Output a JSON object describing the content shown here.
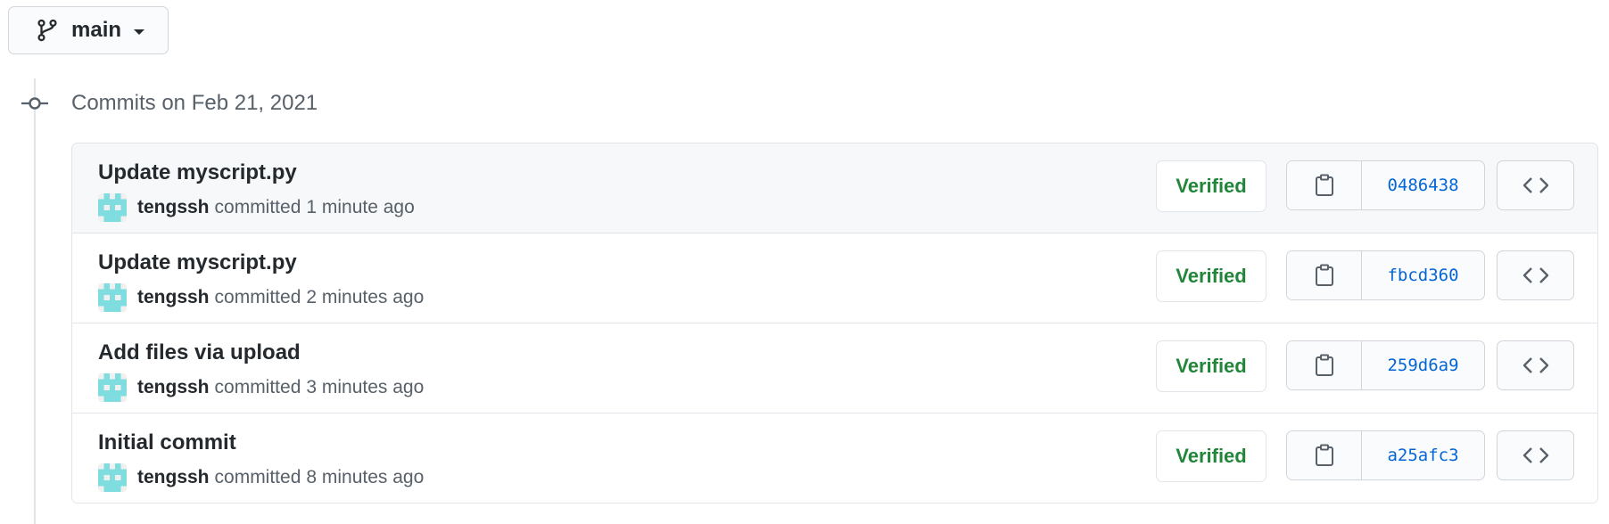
{
  "branch": {
    "name": "main",
    "icon": "git-branch-icon"
  },
  "group": {
    "heading": "Commits on Feb 21, 2021"
  },
  "commits": [
    {
      "title": "Update myscript.py",
      "author": "tengssh",
      "committed_word": "committed",
      "time": "1 minute ago",
      "badge": "Verified",
      "sha": "0486438"
    },
    {
      "title": "Update myscript.py",
      "author": "tengssh",
      "committed_word": "committed",
      "time": "2 minutes ago",
      "badge": "Verified",
      "sha": "fbcd360"
    },
    {
      "title": "Add files via upload",
      "author": "tengssh",
      "committed_word": "committed",
      "time": "3 minutes ago",
      "badge": "Verified",
      "sha": "259d6a9"
    },
    {
      "title": "Initial commit",
      "author": "tengssh",
      "committed_word": "committed",
      "time": "8 minutes ago",
      "badge": "Verified",
      "sha": "a25afc3"
    }
  ],
  "colors": {
    "verified": "#22863a",
    "sha_link": "#0366d6",
    "border": "#e1e4e8",
    "avatar": "#7fdde0"
  },
  "icons": {
    "copy": "clipboard-icon",
    "browse": "code-icon",
    "timeline": "git-commit-icon"
  }
}
